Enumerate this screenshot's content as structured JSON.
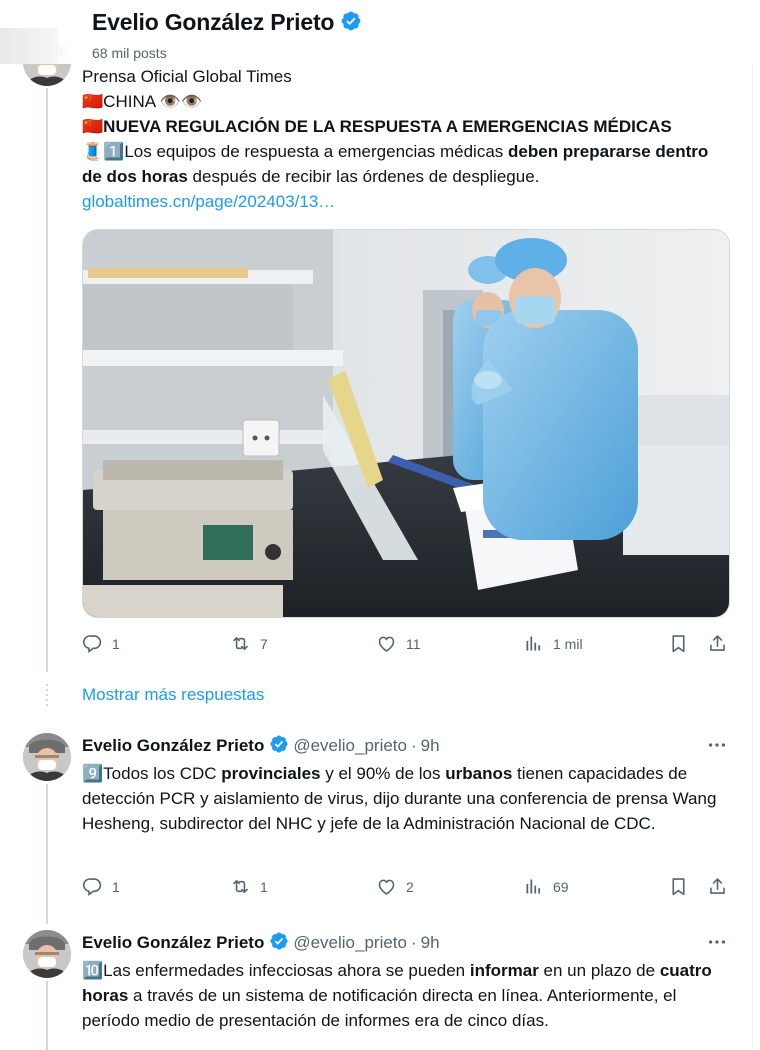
{
  "header": {
    "name": "Evelio González Prieto",
    "posts_count": "68 mil posts"
  },
  "tweet1": {
    "line1": "Prensa Oficial Global Times",
    "line2_flag": "🇨🇳",
    "line2_text": "CHINA",
    "line2_emoji": "👁️👁️",
    "line3_flag": "🇨🇳",
    "line3_text": "NUEVA REGULACIÓN DE LA RESPUESTA A EMERGENCIAS MÉDICAS",
    "line4_emoji": "🧵1️⃣",
    "line4_a": "Los equipos de respuesta a emergencias médicas ",
    "line4_b": "deben prepararse dentro de dos horas",
    "line4_c": " después de recibir las órdenes de despliegue.",
    "link": "globaltimes.cn/page/202403/13…",
    "replies": "1",
    "reposts": "7",
    "likes": "11",
    "views": "1 mil"
  },
  "show_more": "Mostrar más respuestas",
  "tweet2": {
    "name": "Evelio González Prieto",
    "handle": "@evelio_prieto",
    "dot": "·",
    "time": "9h",
    "emoji": "9️⃣",
    "text_a": "Todos los CDC ",
    "text_b": "provinciales",
    "text_c": " y el 90% de los ",
    "text_d": "urbanos",
    "text_e": " tienen capacidades de detección PCR y aislamiento de virus, dijo durante una conferencia de prensa Wang Hesheng, subdirector del NHC y jefe de la Administración Nacional de CDC.",
    "replies": "1",
    "reposts": "1",
    "likes": "2",
    "views": "69"
  },
  "tweet3": {
    "name": "Evelio González Prieto",
    "handle": "@evelio_prieto",
    "dot": "·",
    "time": "9h",
    "emoji": "🔟",
    "text_a": "Las enfermedades infecciosas ahora se pueden ",
    "text_b": "informar",
    "text_c": " en un plazo de ",
    "text_d": "cuatro horas",
    "text_e": " a través de un sistema de notificación directa en línea. Anteriormente, el período medio de presentación de informes era de cinco días."
  },
  "colors": {
    "accent": "#1d9bf0",
    "text": "#0f1419",
    "muted": "#536471"
  },
  "icons": [
    "verified-badge-icon",
    "reply-icon",
    "repost-icon",
    "like-icon",
    "views-icon",
    "bookmark-icon",
    "share-icon",
    "more-icon"
  ]
}
